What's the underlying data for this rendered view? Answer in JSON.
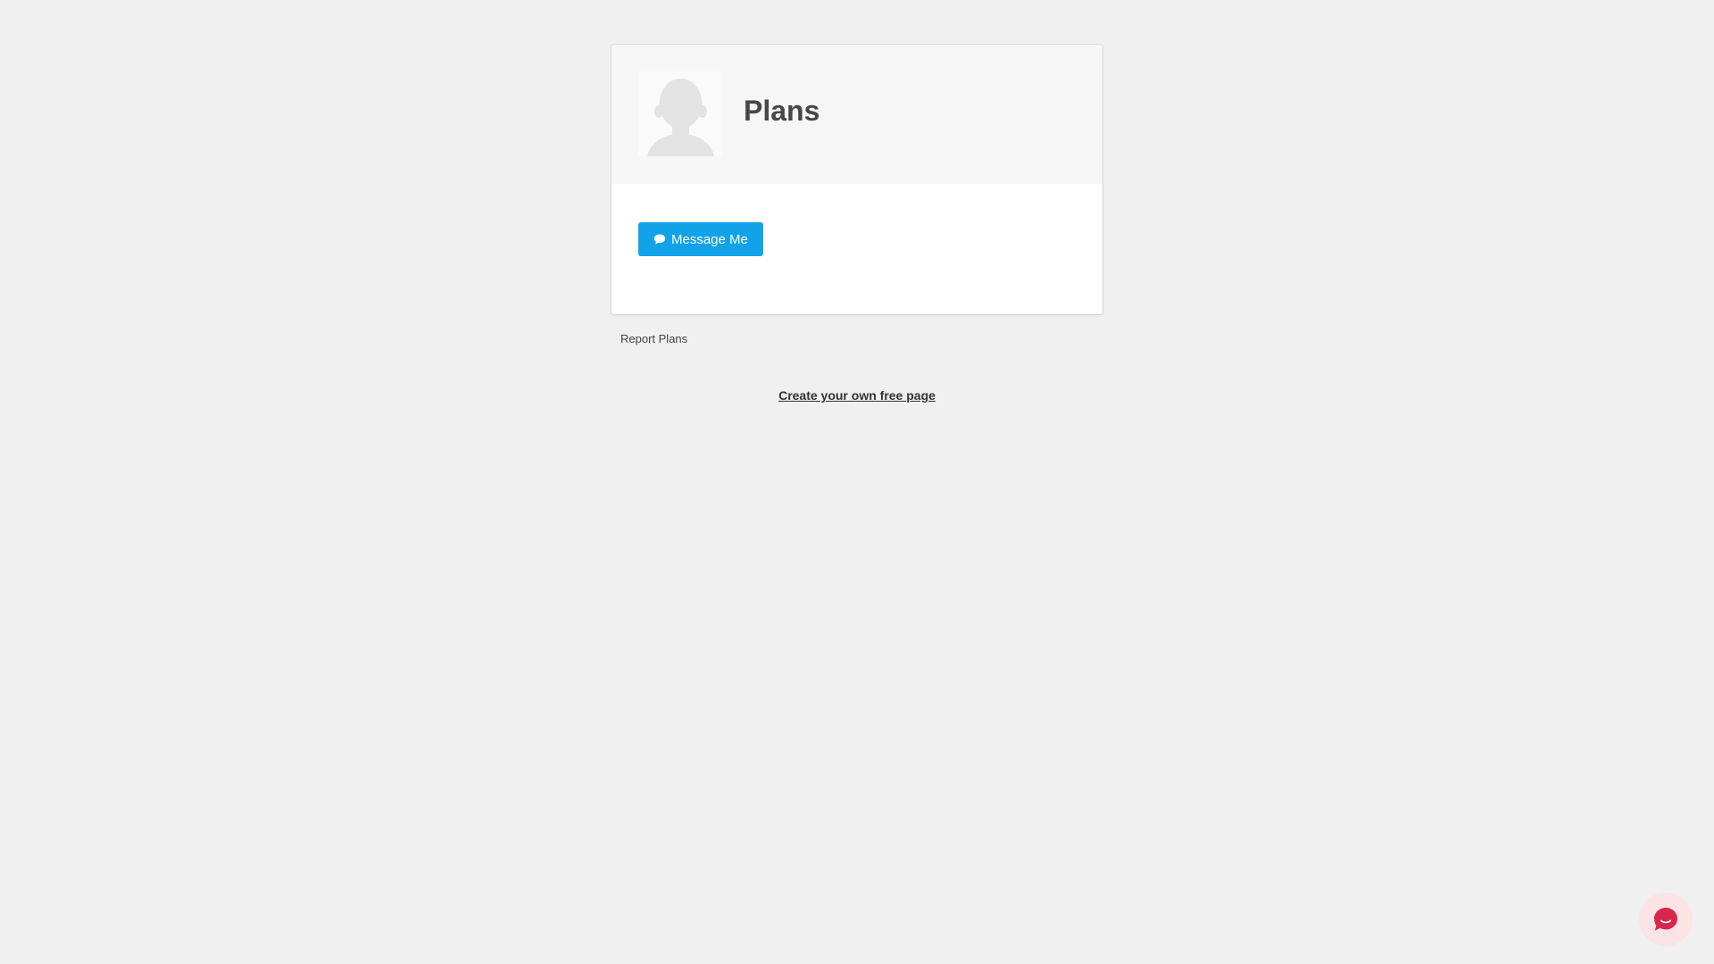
{
  "profile": {
    "title": "Plans",
    "avatar_icon": "default-user-silhouette-icon"
  },
  "actions": {
    "message_button_label": "Message Me",
    "message_icon": "chat-bubble-icon",
    "button_color": "#12a2e8"
  },
  "footer": {
    "report_link": "Report Plans",
    "create_link": "Create your own free page"
  },
  "chat_widget": {
    "icon": "chat-bubble-icon",
    "color": "#d8264d",
    "background": "#fbe3e6"
  }
}
